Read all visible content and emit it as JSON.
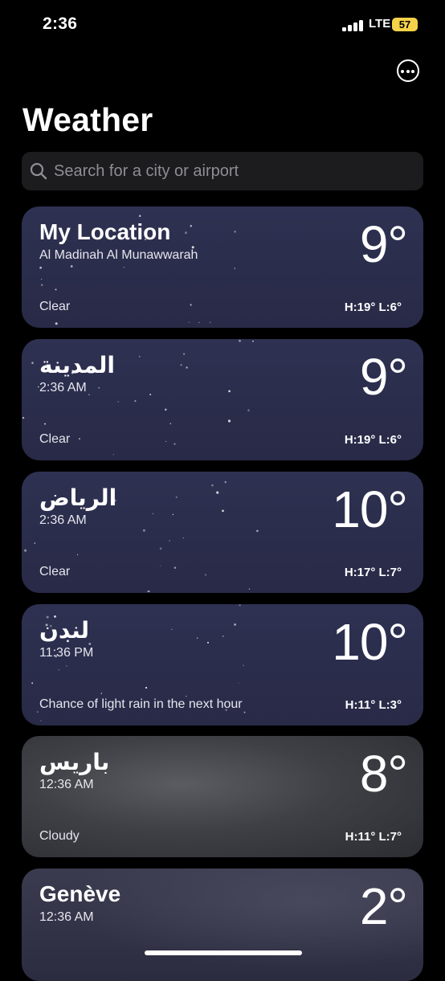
{
  "status_bar": {
    "time": "2:36",
    "network": "LTE",
    "battery": "57"
  },
  "header": {
    "title": "Weather",
    "menu_icon": "ellipsis-circle-icon"
  },
  "search": {
    "placeholder": "Search for a city or airport",
    "icon": "search-icon"
  },
  "colors": {
    "background": "#000000",
    "battery": "#f6d24a",
    "search_bg": "#1c1c1e",
    "night_card": "#2c2e4d"
  },
  "cards": [
    {
      "city": "My Location",
      "subtitle": "Al Madinah Al Munawwarah",
      "temp": "9°",
      "condition": "Clear",
      "hl": "H:19°  L:6°",
      "style": "night"
    },
    {
      "city": "المدينة",
      "subtitle": "2:36 AM",
      "temp": "9°",
      "condition": "Clear",
      "hl": "H:19°  L:6°",
      "style": "night"
    },
    {
      "city": "الرياض",
      "subtitle": "2:36 AM",
      "temp": "10°",
      "condition": "Clear",
      "hl": "H:17°  L:7°",
      "style": "night"
    },
    {
      "city": "لندن",
      "subtitle": "11:36 PM",
      "temp": "10°",
      "condition": "Chance of light rain in the next hour",
      "hl": "H:11°  L:3°",
      "style": "night"
    },
    {
      "city": "باريس",
      "subtitle": "12:36 AM",
      "temp": "8°",
      "condition": "Cloudy",
      "hl": "H:11°  L:7°",
      "style": "cloudy"
    },
    {
      "city": "Genève",
      "subtitle": "12:36 AM",
      "temp": "2°",
      "condition": "",
      "hl": "",
      "style": "night-cloudy"
    }
  ]
}
